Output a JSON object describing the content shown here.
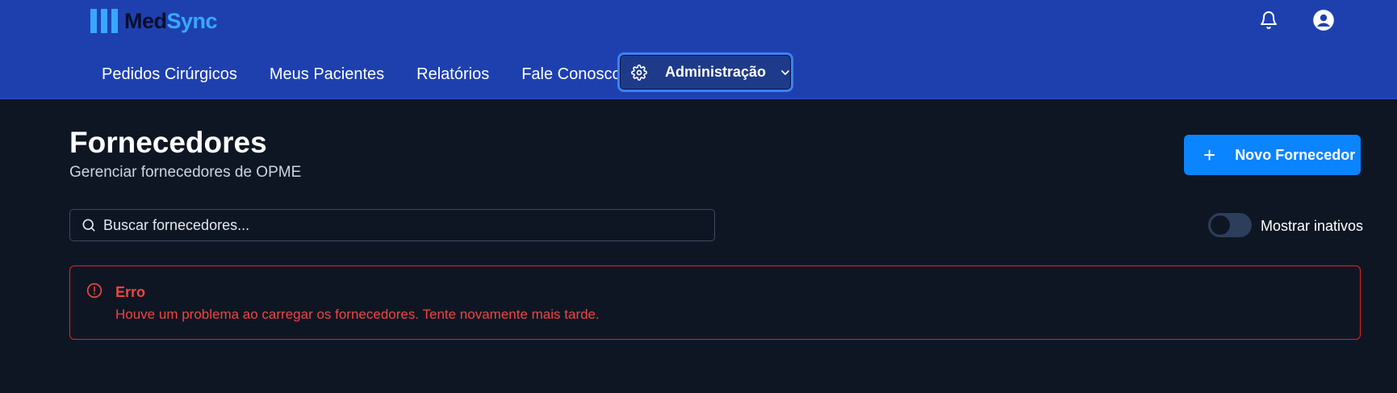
{
  "brand": {
    "name_part1": "Med",
    "name_part2": "Sync",
    "accent": "#38a8ff"
  },
  "header": {
    "background": "#1e40af",
    "icons": [
      "bell-icon",
      "user-circle-icon"
    ]
  },
  "nav": {
    "items": [
      "Pedidos Cirúrgicos",
      "Meus Pacientes",
      "Relatórios",
      "Fale Conosco"
    ],
    "admin": {
      "label": "Administração",
      "icon": "gear-icon",
      "expanded_indicator": "chevron-down-icon"
    }
  },
  "page": {
    "title": "Fornecedores",
    "subtitle": "Gerenciar fornecedores de OPME"
  },
  "actions": {
    "new_button": "Novo Fornecedor",
    "new_icon": "plus-icon"
  },
  "search": {
    "placeholder": "Buscar fornecedores...",
    "value": ""
  },
  "filters": {
    "show_inactive_label": "Mostrar inativos",
    "show_inactive": false
  },
  "alert": {
    "title": "Erro",
    "message": "Houve um problema ao carregar os fornecedores. Tente novamente mais tarde.",
    "color": "#ef4444"
  }
}
